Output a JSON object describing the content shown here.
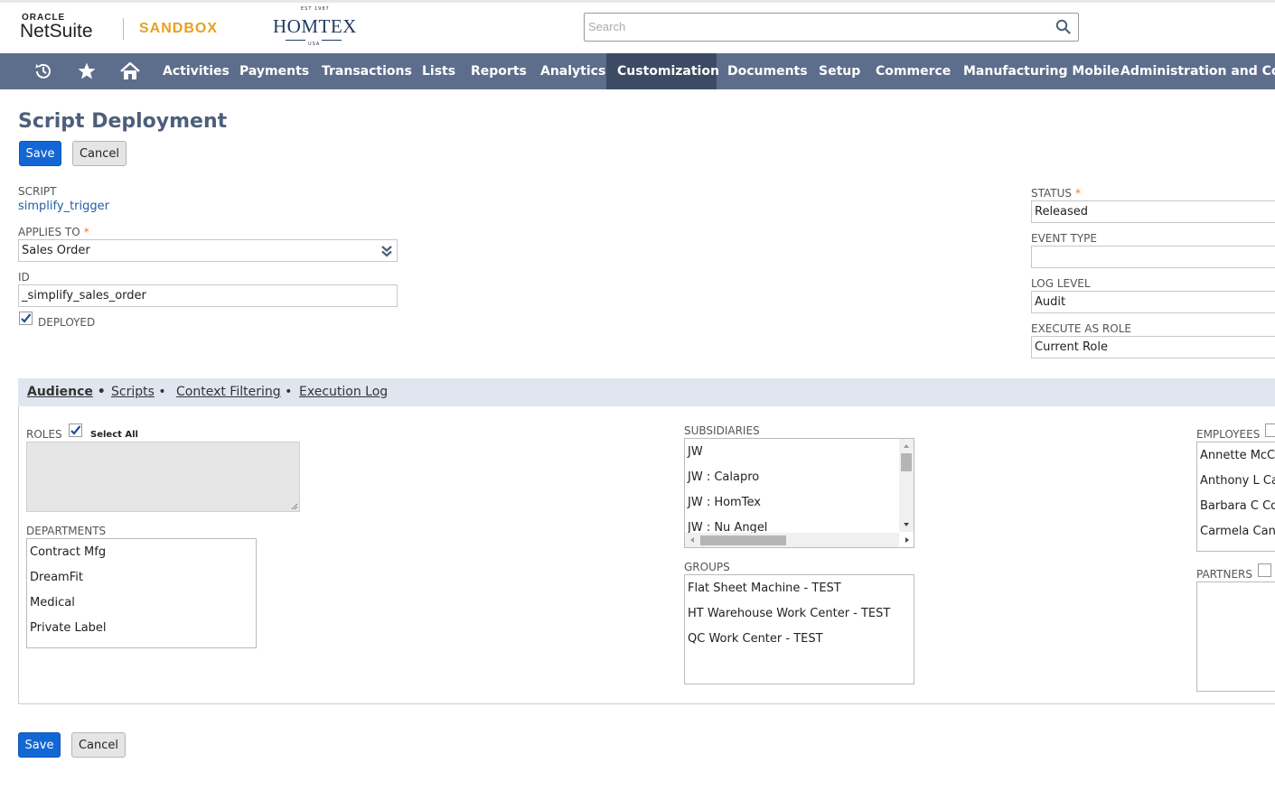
{
  "brand": {
    "oracle": "ORACLE",
    "netsuite": "NetSuite",
    "env": "SANDBOX",
    "company_est": "EST 1987",
    "company_name": "HOMTEX",
    "company_country": "USA"
  },
  "search": {
    "placeholder": "Search",
    "value": ""
  },
  "nav": {
    "icons": [
      "recent-icon",
      "star-icon",
      "home-icon"
    ],
    "items": [
      "Activities",
      "Payments",
      "Transactions",
      "Lists",
      "Reports",
      "Analytics",
      "Customization",
      "Documents",
      "Setup",
      "Commerce",
      "Manufacturing Mobile",
      "Administration and Contr"
    ],
    "active": "Customization"
  },
  "page": {
    "title": "Script Deployment"
  },
  "buttons": {
    "save": "Save",
    "cancel": "Cancel"
  },
  "form": {
    "script_label": "SCRIPT",
    "script_value": "simplify_trigger",
    "applies_to_label": "APPLIES TO",
    "applies_to_value": "Sales Order",
    "id_label": "ID",
    "id_value": "_simplify_sales_order",
    "deployed_label": "DEPLOYED",
    "deployed_checked": true,
    "status_label": "STATUS",
    "status_value": "Released",
    "event_type_label": "EVENT TYPE",
    "event_type_value": "",
    "log_level_label": "LOG LEVEL",
    "log_level_value": "Audit",
    "execute_as_role_label": "EXECUTE AS ROLE",
    "execute_as_role_value": "Current Role",
    "required_mark": "*"
  },
  "tabs": [
    {
      "label": "Audience",
      "marker": "•"
    },
    {
      "label": "Scripts",
      "marker": "•"
    },
    {
      "label": "Context Filtering",
      "marker": "•"
    },
    {
      "label": "Execution Log",
      "marker": ""
    }
  ],
  "audience": {
    "roles_label": "ROLES",
    "select_all_label": "Select All",
    "select_all_checked": true,
    "departments_label": "DEPARTMENTS",
    "departments": [
      "Contract Mfg",
      "DreamFit",
      "Medical",
      "Private Label"
    ],
    "subsidiaries_label": "SUBSIDIARIES",
    "subsidiaries": [
      "JW",
      "JW : Calapro",
      "JW : HomTex",
      "JW : Nu Angel"
    ],
    "groups_label": "GROUPS",
    "groups": [
      "Flat Sheet Machine - TEST",
      "HT Warehouse Work Center - TEST",
      "QC Work Center - TEST"
    ],
    "employees_label": "EMPLOYEES",
    "employees": [
      "Annette McCl",
      "Anthony L Car",
      "Barbara C Col",
      "Carmela Canc"
    ],
    "partners_label": "PARTNERS"
  },
  "colors": {
    "nav_bg": "#5d6e8c",
    "nav_active": "#3c4a63",
    "save_blue": "#1367d5",
    "title": "#4d5f7a",
    "required": "#e5792b",
    "sandbox": "#e8a020"
  }
}
